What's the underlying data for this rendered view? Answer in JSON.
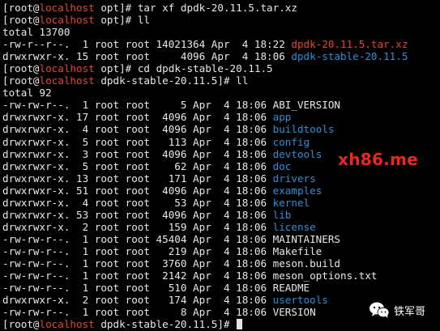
{
  "colors": {
    "background": "#000000",
    "default": "#e8e8e8",
    "host": "#e6452e",
    "directory": "#2e8fd6",
    "archive": "#e6452e",
    "watermark": "#e8291c"
  },
  "terminal": {
    "lines": [
      {
        "segments": [
          {
            "text": "[root@",
            "color": "default"
          },
          {
            "text": "localhost",
            "color": "host"
          },
          {
            "text": " opt]# tar xf dpdk-20.11.5.tar.xz",
            "color": "default"
          }
        ]
      },
      {
        "segments": [
          {
            "text": "[root@",
            "color": "default"
          },
          {
            "text": "localhost",
            "color": "host"
          },
          {
            "text": " opt]# ll",
            "color": "default"
          }
        ]
      },
      {
        "segments": [
          {
            "text": "total 13700",
            "color": "default"
          }
        ]
      },
      {
        "segments": [
          {
            "text": "-rw-r--r--.  1 root root 14021364 Apr  4 18:22 ",
            "color": "default"
          },
          {
            "text": "dpdk-20.11.5.tar.xz",
            "color": "archive"
          }
        ]
      },
      {
        "segments": [
          {
            "text": "drwxrwxr-x. 15 root root     4096 Apr  4 18:06 ",
            "color": "default"
          },
          {
            "text": "dpdk-stable-20.11.5",
            "color": "directory"
          }
        ]
      },
      {
        "segments": [
          {
            "text": "[root@",
            "color": "default"
          },
          {
            "text": "localhost",
            "color": "host"
          },
          {
            "text": " opt]# cd dpdk-stable-20.11.5",
            "color": "default"
          }
        ]
      },
      {
        "segments": [
          {
            "text": "[root@",
            "color": "default"
          },
          {
            "text": "localhost",
            "color": "host"
          },
          {
            "text": " dpdk-stable-20.11.5]# ll",
            "color": "default"
          }
        ]
      },
      {
        "segments": [
          {
            "text": "total 92",
            "color": "default"
          }
        ]
      },
      {
        "segments": [
          {
            "text": "-rw-rw-r--.  1 root root     5 Apr  4 18:06 ABI_VERSION",
            "color": "default"
          }
        ]
      },
      {
        "segments": [
          {
            "text": "drwxrwxr-x. 17 root root  4096 Apr  4 18:06 ",
            "color": "default"
          },
          {
            "text": "app",
            "color": "directory"
          }
        ]
      },
      {
        "segments": [
          {
            "text": "drwxrwxr-x.  4 root root  4096 Apr  4 18:06 ",
            "color": "default"
          },
          {
            "text": "buildtools",
            "color": "directory"
          }
        ]
      },
      {
        "segments": [
          {
            "text": "drwxrwxr-x.  5 root root   113 Apr  4 18:06 ",
            "color": "default"
          },
          {
            "text": "config",
            "color": "directory"
          }
        ]
      },
      {
        "segments": [
          {
            "text": "drwxrwxr-x.  3 root root  4096 Apr  4 18:06 ",
            "color": "default"
          },
          {
            "text": "devtools",
            "color": "directory"
          }
        ]
      },
      {
        "segments": [
          {
            "text": "drwxrwxr-x.  5 root root    62 Apr  4 18:06 ",
            "color": "default"
          },
          {
            "text": "doc",
            "color": "directory"
          }
        ]
      },
      {
        "segments": [
          {
            "text": "drwxrwxr-x. 13 root root   171 Apr  4 18:06 ",
            "color": "default"
          },
          {
            "text": "drivers",
            "color": "directory"
          }
        ]
      },
      {
        "segments": [
          {
            "text": "drwxrwxr-x. 51 root root  4096 Apr  4 18:06 ",
            "color": "default"
          },
          {
            "text": "examples",
            "color": "directory"
          }
        ]
      },
      {
        "segments": [
          {
            "text": "drwxrwxr-x.  4 root root    53 Apr  4 18:06 ",
            "color": "default"
          },
          {
            "text": "kernel",
            "color": "directory"
          }
        ]
      },
      {
        "segments": [
          {
            "text": "drwxrwxr-x. 53 root root  4096 Apr  4 18:06 ",
            "color": "default"
          },
          {
            "text": "lib",
            "color": "directory"
          }
        ]
      },
      {
        "segments": [
          {
            "text": "drwxrwxr-x.  2 root root   159 Apr  4 18:06 ",
            "color": "default"
          },
          {
            "text": "license",
            "color": "directory"
          }
        ]
      },
      {
        "segments": [
          {
            "text": "-rw-rw-r--.  1 root root 45404 Apr  4 18:06 MAINTAINERS",
            "color": "default"
          }
        ]
      },
      {
        "segments": [
          {
            "text": "-rw-rw-r--.  1 root root   219 Apr  4 18:06 Makefile",
            "color": "default"
          }
        ]
      },
      {
        "segments": [
          {
            "text": "-rw-rw-r--.  1 root root  3760 Apr  4 18:06 meson.build",
            "color": "default"
          }
        ]
      },
      {
        "segments": [
          {
            "text": "-rw-rw-r--.  1 root root  2142 Apr  4 18:06 meson_options.txt",
            "color": "default"
          }
        ]
      },
      {
        "segments": [
          {
            "text": "-rw-rw-r--.  1 root root   510 Apr  4 18:06 README",
            "color": "default"
          }
        ]
      },
      {
        "segments": [
          {
            "text": "drwxrwxr-x.  2 root root   174 Apr  4 18:06 ",
            "color": "default"
          },
          {
            "text": "usertools",
            "color": "directory"
          }
        ]
      },
      {
        "segments": [
          {
            "text": "-rw-rw-r--.  1 root root     8 Apr  4 18:06 VERSION",
            "color": "default"
          }
        ]
      },
      {
        "segments": [
          {
            "text": "[root@",
            "color": "default"
          },
          {
            "text": "localhost",
            "color": "host"
          },
          {
            "text": " dpdk-stable-20.11.5]# ",
            "color": "default"
          }
        ],
        "cursor": true
      }
    ]
  },
  "watermark": {
    "text": "xh86.me"
  },
  "badge": {
    "icon": "wechat-icon",
    "text": "铁军哥"
  }
}
